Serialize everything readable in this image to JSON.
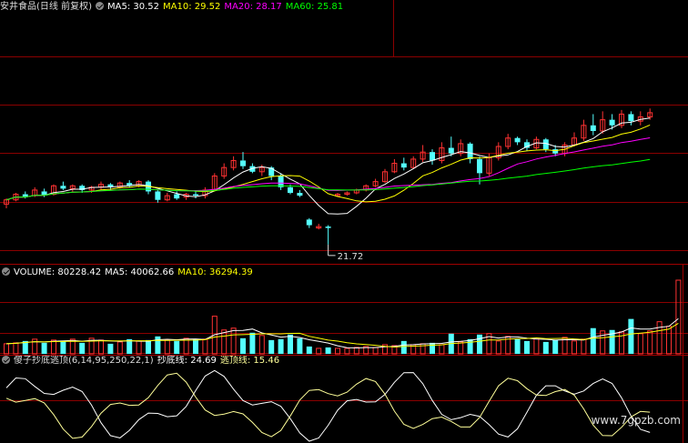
{
  "colors": {
    "up": "#ff3232",
    "down": "#54ffff",
    "ma5": "#ffffff",
    "ma10": "#ffff00",
    "ma20": "#ff00ff",
    "ma60": "#00ff00",
    "grid": "#8b0000",
    "indicator_white": "#ffffff",
    "indicator_yellow": "#ffff99"
  },
  "price_panel": {
    "stock_name": "安井食品(日线 前复权)",
    "ma5": "MA5: 30.52",
    "ma10": "MA10: 29.52",
    "ma20": "MA20: 28.17",
    "ma60": "MA60: 25.81",
    "low_marker": "21.72"
  },
  "volume_panel": {
    "volume": "VOLUME: 80228.42",
    "ma5": "MA5: 40062.66",
    "ma10": "MA10: 36294.39"
  },
  "indicator_panel": {
    "name": "傻子抄底逃顶(6,14,95,250,22,1)",
    "bottom_line": "抄底线: 24.69",
    "top_line": "逃顶线: 15.46"
  },
  "watermark": "www.7gpzb.com",
  "chart_data": [
    {
      "type": "candlestick",
      "title": "安井食品(日线 前复权)",
      "series": [
        {
          "name": "MA5",
          "last": 30.52
        },
        {
          "name": "MA10",
          "last": 29.52
        },
        {
          "name": "MA20",
          "last": 28.17
        },
        {
          "name": "MA60",
          "last": 25.81
        }
      ],
      "annotations": [
        "21.72"
      ],
      "candles": [
        {
          "o": 24.6,
          "c": 24.9,
          "h": 25.0,
          "l": 24.3
        },
        {
          "o": 24.9,
          "c": 25.3,
          "h": 25.4,
          "l": 24.8
        },
        {
          "o": 25.3,
          "c": 25.1,
          "h": 25.5,
          "l": 25.0
        },
        {
          "o": 25.2,
          "c": 25.6,
          "h": 25.8,
          "l": 25.1
        },
        {
          "o": 25.5,
          "c": 25.2,
          "h": 25.7,
          "l": 25.1
        },
        {
          "o": 25.3,
          "c": 25.9,
          "h": 26.0,
          "l": 25.2
        },
        {
          "o": 25.9,
          "c": 25.7,
          "h": 26.2,
          "l": 25.6
        },
        {
          "o": 25.7,
          "c": 25.9,
          "h": 26.0,
          "l": 25.5
        },
        {
          "o": 25.9,
          "c": 25.6,
          "h": 26.0,
          "l": 25.4
        },
        {
          "o": 25.6,
          "c": 25.8,
          "h": 25.9,
          "l": 25.4
        },
        {
          "o": 25.8,
          "c": 26.0,
          "h": 26.2,
          "l": 25.6
        },
        {
          "o": 26.0,
          "c": 25.8,
          "h": 26.1,
          "l": 25.6
        },
        {
          "o": 25.8,
          "c": 26.1,
          "h": 26.2,
          "l": 25.7
        },
        {
          "o": 26.1,
          "c": 25.9,
          "h": 26.3,
          "l": 25.8
        },
        {
          "o": 25.9,
          "c": 26.2,
          "h": 26.3,
          "l": 25.8
        },
        {
          "o": 26.2,
          "c": 25.5,
          "h": 26.3,
          "l": 25.3
        },
        {
          "o": 25.5,
          "c": 24.9,
          "h": 25.6,
          "l": 24.7
        },
        {
          "o": 24.9,
          "c": 25.2,
          "h": 25.4,
          "l": 24.8
        },
        {
          "o": 25.3,
          "c": 25.0,
          "h": 25.5,
          "l": 24.9
        },
        {
          "o": 25.1,
          "c": 25.3,
          "h": 25.4,
          "l": 24.9
        },
        {
          "o": 25.3,
          "c": 25.2,
          "h": 25.5,
          "l": 25.0
        },
        {
          "o": 25.2,
          "c": 25.6,
          "h": 25.8,
          "l": 25.0
        },
        {
          "o": 25.6,
          "c": 26.6,
          "h": 26.8,
          "l": 25.5
        },
        {
          "o": 26.6,
          "c": 27.2,
          "h": 27.5,
          "l": 26.4
        },
        {
          "o": 27.2,
          "c": 27.7,
          "h": 28.0,
          "l": 27.0
        },
        {
          "o": 27.7,
          "c": 27.3,
          "h": 28.3,
          "l": 27.1
        },
        {
          "o": 27.3,
          "c": 26.9,
          "h": 27.5,
          "l": 26.8
        },
        {
          "o": 26.9,
          "c": 27.2,
          "h": 27.4,
          "l": 26.6
        },
        {
          "o": 27.2,
          "c": 26.6,
          "h": 27.3,
          "l": 26.3
        },
        {
          "o": 26.6,
          "c": 25.8,
          "h": 26.8,
          "l": 25.6
        },
        {
          "o": 25.8,
          "c": 25.4,
          "h": 26.0,
          "l": 25.3
        },
        {
          "o": 25.4,
          "c": 25.2,
          "h": 25.6,
          "l": 25.1
        },
        {
          "o": 23.5,
          "c": 23.1,
          "h": 23.6,
          "l": 22.9
        },
        {
          "o": 22.9,
          "c": 23.0,
          "h": 23.2,
          "l": 22.8
        },
        {
          "o": 23.0,
          "c": 22.9,
          "h": 23.1,
          "l": 21.72
        },
        {
          "o": 25.2,
          "c": 25.3,
          "h": 25.4,
          "l": 25.1
        },
        {
          "o": 25.3,
          "c": 25.4,
          "h": 25.5,
          "l": 25.2
        },
        {
          "o": 25.4,
          "c": 25.6,
          "h": 25.7,
          "l": 25.3
        },
        {
          "o": 25.6,
          "c": 25.9,
          "h": 26.0,
          "l": 25.5
        },
        {
          "o": 25.9,
          "c": 26.2,
          "h": 26.4,
          "l": 25.8
        },
        {
          "o": 26.2,
          "c": 26.9,
          "h": 27.1,
          "l": 26.1
        },
        {
          "o": 26.9,
          "c": 27.5,
          "h": 27.8,
          "l": 26.8
        },
        {
          "o": 27.5,
          "c": 27.2,
          "h": 27.9,
          "l": 27.0
        },
        {
          "o": 27.2,
          "c": 27.8,
          "h": 28.0,
          "l": 27.1
        },
        {
          "o": 27.8,
          "c": 28.3,
          "h": 28.8,
          "l": 27.6
        },
        {
          "o": 28.3,
          "c": 27.7,
          "h": 28.5,
          "l": 27.4
        },
        {
          "o": 27.7,
          "c": 28.6,
          "h": 29.0,
          "l": 27.5
        },
        {
          "o": 28.6,
          "c": 28.2,
          "h": 29.4,
          "l": 28.0
        },
        {
          "o": 28.2,
          "c": 28.9,
          "h": 29.2,
          "l": 28.0
        },
        {
          "o": 28.9,
          "c": 27.8,
          "h": 29.0,
          "l": 27.5
        },
        {
          "o": 27.8,
          "c": 26.8,
          "h": 28.0,
          "l": 26.0
        },
        {
          "o": 26.8,
          "c": 27.9,
          "h": 28.2,
          "l": 26.6
        },
        {
          "o": 27.9,
          "c": 28.7,
          "h": 29.0,
          "l": 27.7
        },
        {
          "o": 28.7,
          "c": 29.3,
          "h": 29.6,
          "l": 28.5
        },
        {
          "o": 29.3,
          "c": 29.0,
          "h": 29.4,
          "l": 28.8
        },
        {
          "o": 29.0,
          "c": 28.6,
          "h": 29.2,
          "l": 28.4
        },
        {
          "o": 28.6,
          "c": 29.2,
          "h": 29.4,
          "l": 28.5
        },
        {
          "o": 29.2,
          "c": 28.5,
          "h": 29.3,
          "l": 28.3
        },
        {
          "o": 28.5,
          "c": 28.2,
          "h": 28.8,
          "l": 28.0
        },
        {
          "o": 28.2,
          "c": 28.8,
          "h": 29.0,
          "l": 28.0
        },
        {
          "o": 28.8,
          "c": 29.3,
          "h": 29.7,
          "l": 28.7
        },
        {
          "o": 29.3,
          "c": 30.2,
          "h": 30.6,
          "l": 29.1
        },
        {
          "o": 30.2,
          "c": 29.8,
          "h": 31.0,
          "l": 29.5
        },
        {
          "o": 29.8,
          "c": 30.6,
          "h": 31.2,
          "l": 29.6
        },
        {
          "o": 30.6,
          "c": 30.2,
          "h": 31.0,
          "l": 29.9
        },
        {
          "o": 30.2,
          "c": 31.0,
          "h": 31.3,
          "l": 30.0
        },
        {
          "o": 31.0,
          "c": 30.5,
          "h": 31.2,
          "l": 30.2
        },
        {
          "o": 30.5,
          "c": 30.8,
          "h": 31.2,
          "l": 30.2
        },
        {
          "o": 30.8,
          "c": 31.1,
          "h": 31.4,
          "l": 30.6
        }
      ]
    },
    {
      "type": "bar",
      "title": "VOLUME",
      "series": [
        {
          "name": "VOLUME",
          "last": 80228.42
        },
        {
          "name": "MA5",
          "last": 40062.66
        },
        {
          "name": "MA10",
          "last": 36294.39
        }
      ],
      "values": [
        11000,
        12000,
        14000,
        16000,
        12000,
        15000,
        14000,
        16000,
        12000,
        17000,
        15000,
        11000,
        13000,
        16000,
        14000,
        15000,
        19000,
        15000,
        14000,
        17000,
        16000,
        16000,
        41000,
        26000,
        28000,
        17000,
        23000,
        20000,
        15000,
        16000,
        21000,
        17000,
        8000,
        6000,
        7000,
        6000,
        6000,
        7000,
        8000,
        7000,
        10000,
        9000,
        14000,
        10000,
        11000,
        12000,
        10000,
        22000,
        13000,
        16000,
        21000,
        22000,
        14000,
        19000,
        16000,
        14000,
        17000,
        13000,
        15000,
        18000,
        14000,
        16000,
        28000,
        25000,
        26000,
        24000,
        38000,
        22000,
        25000,
        35000,
        30000,
        80228
      ]
    },
    {
      "type": "line",
      "title": "傻子抄底逃顶(6,14,95,250,22,1)",
      "series": [
        {
          "name": "抄底线",
          "last": 24.69
        },
        {
          "name": "逃顶线",
          "last": 15.46
        }
      ]
    }
  ]
}
